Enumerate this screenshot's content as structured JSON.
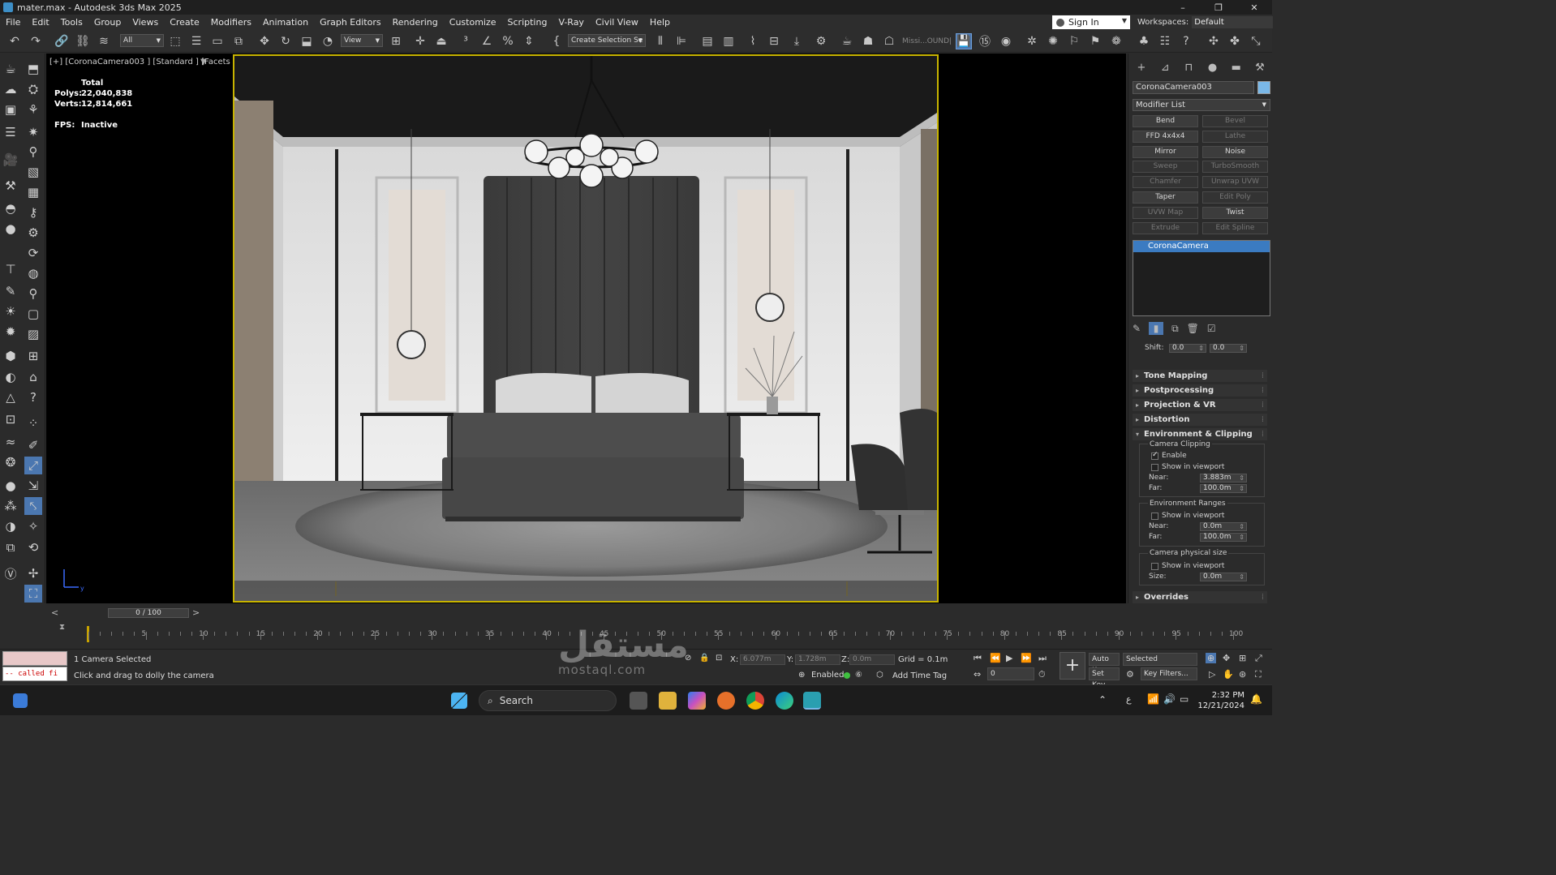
{
  "window": {
    "title": "mater.max - Autodesk 3ds Max 2025",
    "controls": [
      "–",
      "❐",
      "✕"
    ]
  },
  "menu": [
    "File",
    "Edit",
    "Tools",
    "Group",
    "Views",
    "Create",
    "Modifiers",
    "Animation",
    "Graph Editors",
    "Rendering",
    "Customize",
    "Scripting",
    "V-Ray",
    "Civil View",
    "Help"
  ],
  "account": {
    "sign_in": "Sign In",
    "workspaces_label": "Workspaces:",
    "workspace": "Default"
  },
  "toolbar": {
    "selection_filter": "All",
    "ref_coord": "View",
    "named_selection": "Create Selection Se",
    "missing": "Missi...OUND|"
  },
  "viewport": {
    "label": "[+] [CoronaCamera003 ] [Standard ] [Facets ]",
    "stats": {
      "total_label": "Total",
      "polys_label": "Polys:",
      "polys": "22,040,838",
      "verts_label": "Verts:",
      "verts": "12,814,661",
      "fps_label": "FPS:",
      "fps": "Inactive"
    },
    "axis": {
      "x": "x",
      "y": "y"
    }
  },
  "command_panel": {
    "object_name": "CoronaCamera003",
    "object_color": "#7ab8e8",
    "modifier_list": "Modifier List",
    "modifiers": [
      {
        "label": "Bend",
        "enabled": true
      },
      {
        "label": "Bevel",
        "enabled": false
      },
      {
        "label": "FFD 4x4x4",
        "enabled": true
      },
      {
        "label": "Lathe",
        "enabled": false
      },
      {
        "label": "Mirror",
        "enabled": true
      },
      {
        "label": "Noise",
        "enabled": true
      },
      {
        "label": "Sweep",
        "enabled": false
      },
      {
        "label": "TurboSmooth",
        "enabled": false
      },
      {
        "label": "Chamfer",
        "enabled": false
      },
      {
        "label": "Unwrap UVW",
        "enabled": false
      },
      {
        "label": "Taper",
        "enabled": true
      },
      {
        "label": "Edit Poly",
        "enabled": false
      },
      {
        "label": "UVW Map",
        "enabled": false
      },
      {
        "label": "Twist",
        "enabled": true
      },
      {
        "label": "Extrude",
        "enabled": false
      },
      {
        "label": "Edit Spline",
        "enabled": false
      }
    ],
    "stack_item": "CoronaCamera",
    "shift_label": "Shift:",
    "shift_x": "0.0",
    "shift_y": "0.0",
    "rollouts": {
      "tone_mapping": "Tone Mapping",
      "postprocessing": "Postprocessing",
      "projection_vr": "Projection & VR",
      "distortion": "Distortion",
      "env_clipping": "Environment & Clipping",
      "overrides": "Overrides"
    },
    "camera_clipping": {
      "title": "Camera Clipping",
      "enable": "Enable",
      "show": "Show in viewport",
      "near_label": "Near:",
      "near": "3.883m",
      "far_label": "Far:",
      "far": "100.0m"
    },
    "env_ranges": {
      "title": "Environment Ranges",
      "show": "Show in viewport",
      "near_label": "Near:",
      "near": "0.0m",
      "far_label": "Far:",
      "far": "100.0m"
    },
    "physical_size": {
      "title": "Camera physical size",
      "show": "Show in viewport",
      "size_label": "Size:",
      "size": "0.0m"
    }
  },
  "time": {
    "frame": "0 / 100",
    "ticks": [
      "0",
      "5",
      "10",
      "15",
      "20",
      "25",
      "30",
      "35",
      "40",
      "45",
      "50",
      "55",
      "60",
      "65",
      "70",
      "75",
      "80",
      "85",
      "90",
      "95",
      "100"
    ]
  },
  "status": {
    "selected": "1 Camera Selected",
    "prompt": "Click and drag to dolly the camera",
    "listener_error": "-- called fi",
    "x_label": "X:",
    "x": "6.077m",
    "y_label": "Y:",
    "y": "1.728m",
    "z_label": "Z:",
    "z": "0.0m",
    "grid": "Grid = 0.1m",
    "enabled_label": "Enabled:",
    "add_time_tag": "Add Time Tag",
    "auto_key": "Auto Key",
    "set_key": "Set Key",
    "selected_dropdown": "Selected",
    "key_filters": "Key Filters...",
    "frame_field": "0"
  },
  "taskbar": {
    "search": "Search",
    "time": "2:32 PM",
    "date": "12/21/2024",
    "lang": "ع"
  },
  "watermark": {
    "arabic": "مستقل",
    "latin": "mostaql.com"
  }
}
